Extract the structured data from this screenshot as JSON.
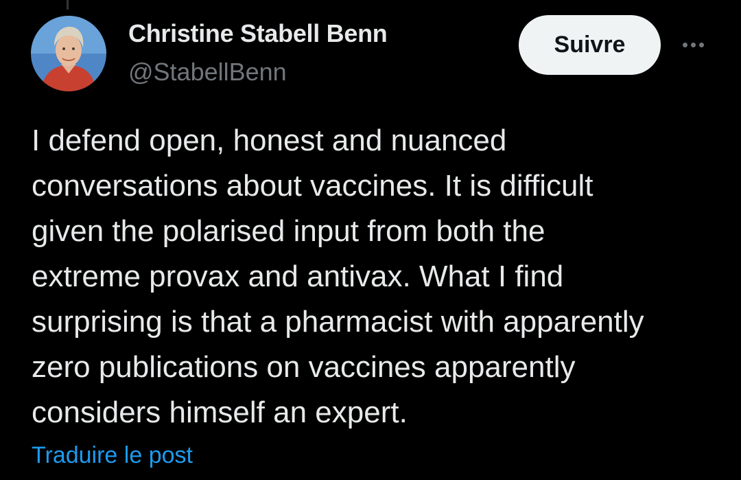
{
  "colors": {
    "background": "#000000",
    "primary_text": "#e7e9ea",
    "secondary_text": "#71767b",
    "link": "#1d9bf0",
    "follow_button_bg": "#eff3f4",
    "follow_button_text": "#0f1419"
  },
  "author": {
    "display_name": "Christine Stabell Benn",
    "handle": "@StabellBenn",
    "avatar_icon": "profile-photo-avatar"
  },
  "actions": {
    "follow_label": "Suivre",
    "more_icon": "more-horizontal-icon"
  },
  "tweet": {
    "lines": [
      "I defend open, honest and nuanced",
      "conversations about vaccines. It is difficult",
      "given the polarised input from both the",
      "extreme provax and antivax. What I find",
      "surprising is that a pharmacist with apparently",
      "zero publications on vaccines apparently",
      "considers himself an expert."
    ],
    "translate_label": "Traduire le post"
  }
}
